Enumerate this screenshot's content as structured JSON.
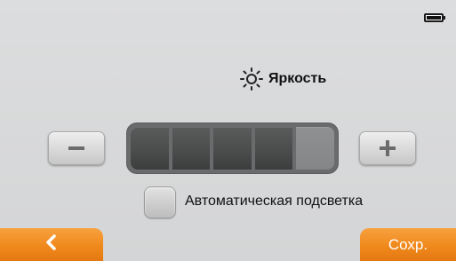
{
  "status": {
    "battery_icon": "battery-full-icon",
    "battery_level": 1.0
  },
  "header": {
    "icon": "sun-icon",
    "title": "Яркость"
  },
  "brightness": {
    "segments_total": 5,
    "segments_filled": 4,
    "decrease_icon": "minus-icon",
    "increase_icon": "plus-icon"
  },
  "auto_backlight": {
    "label": "Автоматическая подсветка",
    "checked": false
  },
  "footer": {
    "back_icon": "chevron-left-icon",
    "save_label": "Сохр."
  },
  "colors": {
    "accent": "#f0891c",
    "background": "#d7d8d9",
    "track": "#4a4b4b"
  }
}
